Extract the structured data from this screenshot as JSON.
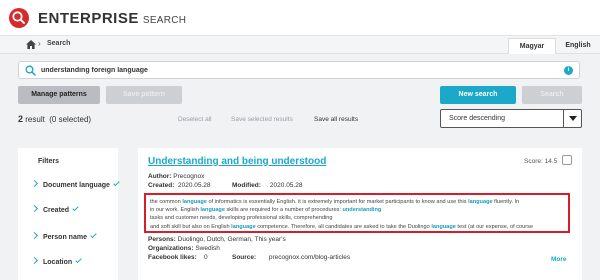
{
  "brand": {
    "name": "ENTERPRISE",
    "sub": "SEARCH"
  },
  "breadcrumb": {
    "current": "Search"
  },
  "languages": {
    "active": "Magyar",
    "other": "English"
  },
  "search": {
    "query": "understanding foreign language",
    "info": "i"
  },
  "buttons": {
    "manage_patterns": "Manage patterns",
    "save_pattern": "Save pattern",
    "new_search": "New search",
    "search": "Search"
  },
  "results": {
    "count": "2",
    "count_label": "result",
    "selected": "(0 selected)",
    "deselect_all": "Deselect all",
    "save_selected": "Save selected results",
    "save_all": "Save all results",
    "sort": "Score descending"
  },
  "filters": {
    "title": "Filters",
    "items": [
      {
        "label": "Document language"
      },
      {
        "label": "Created"
      },
      {
        "label": "Person name"
      },
      {
        "label": "Location"
      }
    ]
  },
  "card": {
    "title": "Understanding and being understood",
    "score": "Score: 14.5",
    "author_label": "Author:",
    "author": "Precognox",
    "created_label": "Created:",
    "created": "2020.05.28",
    "modified_label": "Modified:",
    "modified": "2020.05.28",
    "snippet": [
      [
        {
          "t": "the common "
        },
        {
          "t": "language",
          "h": true
        },
        {
          "t": " of informatics is essentially English. it is extremely important for market participants to know and use this "
        },
        {
          "t": "language",
          "h": true
        },
        {
          "t": " fluently. In"
        }
      ],
      [
        {
          "t": "in our work. English "
        },
        {
          "t": "language",
          "h": true
        },
        {
          "t": " skills are required for a number of procedures: "
        },
        {
          "t": "understanding",
          "h": true
        }
      ],
      [
        {
          "t": "tasks and customer needs, developing professional skills, comprehending"
        }
      ],
      [
        {
          "t": "and soft skill but also on English "
        },
        {
          "t": "language",
          "h": true
        },
        {
          "t": " competence. Therefore, all candidates are asked to take the Duolingo "
        },
        {
          "t": "language",
          "h": true
        },
        {
          "t": " test (at our expense, of course"
        }
      ]
    ],
    "persons_label": "Persons:",
    "persons": "Duolingo, Dutch, German, This year's",
    "orgs_label": "Organizations:",
    "orgs": "Swedish",
    "likes_label": "Facebook likes:",
    "likes": "0",
    "source_label": "Source:",
    "source": "precognox.com/blog-articles",
    "more": "More"
  },
  "colors": {
    "accent": "#1ca9c9",
    "highlight_border": "#d81e2c",
    "logo": "#d62b2b"
  }
}
